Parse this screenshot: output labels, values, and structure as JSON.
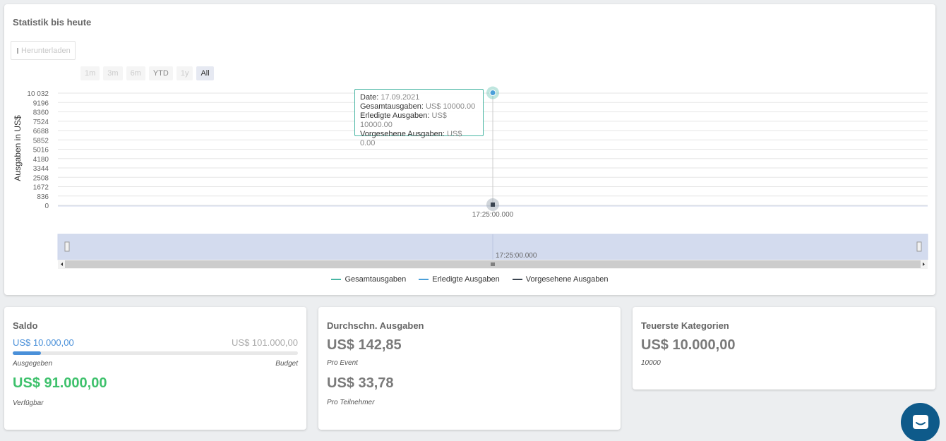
{
  "stat": {
    "title": "Statistik bis heute",
    "download_label": "Herunterladen",
    "ranges": [
      {
        "label": "1m",
        "active": false
      },
      {
        "label": "3m",
        "active": false
      },
      {
        "label": "6m",
        "active": false
      },
      {
        "label": "YTD",
        "active": false
      },
      {
        "label": "1y",
        "active": false
      },
      {
        "label": "All",
        "active": true
      }
    ],
    "tooltip": {
      "date_label": "Date:",
      "date_value": "17.09.2021",
      "total_label": "Gesamtausgaben:",
      "total_value": "US$ 10000.00",
      "done_label": "Erledigte Ausgaben:",
      "done_value": "US$ 10000.00",
      "planned_label": "Vorgesehene Ausgaben:",
      "planned_value": "US$ 0.00"
    },
    "navigator_label": "17:25:00.000"
  },
  "chart_data": {
    "type": "line",
    "ylabel": "Ausgaben in US$",
    "y_ticks": [
      "10 032",
      "9196",
      "8360",
      "7524",
      "6688",
      "5852",
      "5016",
      "4180",
      "3344",
      "2508",
      "1672",
      "836",
      "0"
    ],
    "ylim": [
      0,
      10032
    ],
    "x_ticks": [
      "17:25:00.000"
    ],
    "series": [
      {
        "name": "Gesamtausgaben",
        "color": "#48b6a3",
        "points": [
          {
            "x": "17:25:00.000",
            "y": 10000
          }
        ]
      },
      {
        "name": "Erledigte Ausgaben",
        "color": "#4a9fd9",
        "points": [
          {
            "x": "17:25:00.000",
            "y": 10000
          }
        ]
      },
      {
        "name": "Vorgesehene Ausgaben",
        "color": "#3a4450",
        "points": [
          {
            "x": "17:25:00.000",
            "y": 0
          }
        ]
      }
    ],
    "grid": true,
    "legend": "bottom-center"
  },
  "saldo": {
    "title": "Saldo",
    "spent": "US$ 10.000,00",
    "budget": "US$ 101.000,00",
    "spent_fraction": 0.099,
    "spent_label": "Ausgegeben",
    "budget_label": "Budget",
    "available": "US$ 91.000,00",
    "available_label": "Verfügbar"
  },
  "avg": {
    "title": "Durchschn. Ausgaben",
    "per_event": "US$ 142,85",
    "per_event_label": "Pro Event",
    "per_participant": "US$ 33,78",
    "per_participant_label": "Pro Teilnehmer"
  },
  "top": {
    "title": "Teuerste Kategorien",
    "value": "US$ 10.000,00",
    "category": "10000"
  }
}
